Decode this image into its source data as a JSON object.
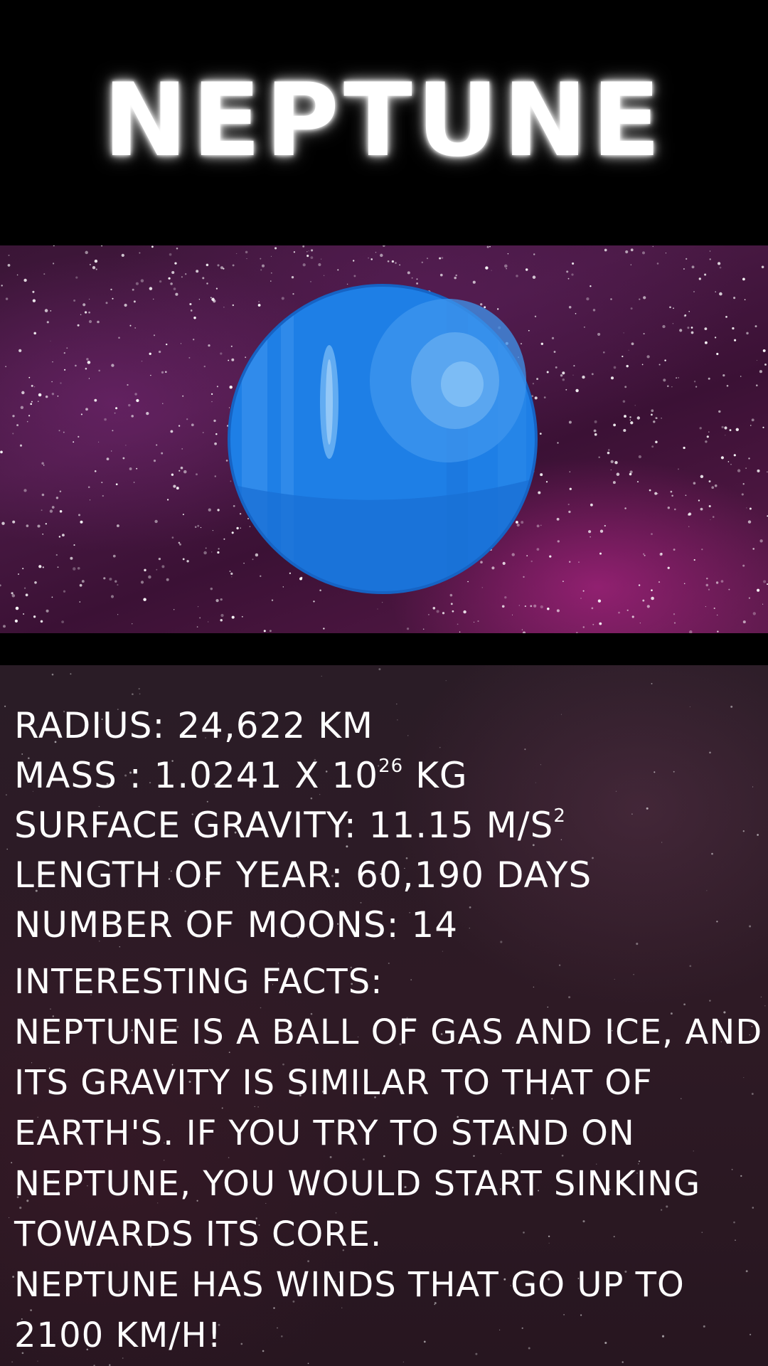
{
  "header": {
    "title": "NEPTUNE"
  },
  "hero": {
    "planet_icon": "neptune-planet-illustration",
    "colors": {
      "planet": "#1e7fe6",
      "planet_highlight": "#5fb0f2",
      "background": "#4a1a45"
    }
  },
  "stats": {
    "radius": "RADIUS: 24,622 KM",
    "mass_prefix": "MASS  : 1.0241 X 10",
    "mass_exponent": "26",
    "mass_suffix": " KG",
    "gravity_prefix": "SURFACE GRAVITY: 11.15 M/S",
    "gravity_exponent": "2",
    "year_length": "LENGTH OF YEAR: 60,190 DAYS",
    "moons": "NUMBER OF MOONS: 14"
  },
  "facts": {
    "heading": "INTERESTING FACTS:",
    "paragraph_1": "NEPTUNE IS A BALL OF GAS AND ICE, AND ITS GRAVITY IS SIMILAR TO THAT OF EARTH'S. IF YOU TRY TO STAND ON NEPTUNE, YOU WOULD START SINKING TOWARDS ITS CORE.",
    "paragraph_2": "NEPTUNE HAS WINDS THAT GO UP TO 2100 KM/H!"
  }
}
